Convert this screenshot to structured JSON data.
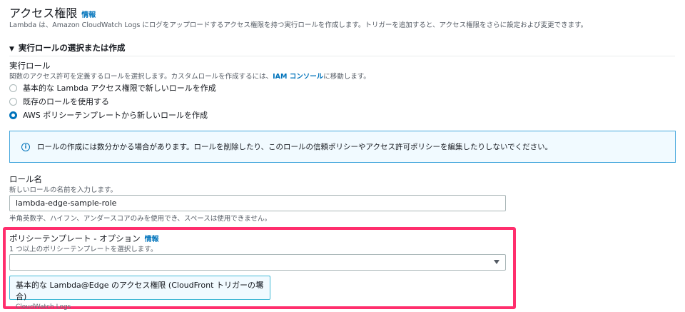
{
  "header": {
    "title": "アクセス権限",
    "info": "情報",
    "description": "Lambda は、Amazon CloudWatch Logs にログをアップロードするアクセス権限を持つ実行ロールを作成します。トリガーを追加すると、アクセス権限をさらに設定および変更できます。"
  },
  "section": {
    "title": "実行ロールの選択または作成"
  },
  "exec_role": {
    "label": "実行ロール",
    "desc_pre": "関数のアクセス許可を定義するロールを選択します。カスタムロールを作成するには、",
    "desc_link": "IAM コンソール",
    "desc_post": "に移動します。",
    "options": [
      {
        "label": "基本的な Lambda アクセス権限で新しいロールを作成",
        "selected": false
      },
      {
        "label": "既存のロールを使用する",
        "selected": false
      },
      {
        "label": "AWS ポリシーテンプレートから新しいロールを作成",
        "selected": true
      }
    ]
  },
  "alert": {
    "text": "ロールの作成には数分かかる場合があります。ロールを削除したり、このロールの信頼ポリシーやアクセス許可ポリシーを編集したりしないでください。"
  },
  "role_name": {
    "label": "ロール名",
    "desc": "新しいロールの名前を入力します。",
    "value": "lambda-edge-sample-role",
    "hint": "半角英数字、ハイフン、アンダースコアのみを使用でき、スペースは使用できません。"
  },
  "policy": {
    "label": "ポリシーテンプレート - オプション",
    "info": "情報",
    "desc": "1 つ以上のポリシーテンプレートを選択します。",
    "select_value": "",
    "tag_title": "基本的な Lambda@Edge のアクセス権限 (CloudFront トリガーの場合)",
    "tag_sub": "CloudWatch Logs"
  }
}
